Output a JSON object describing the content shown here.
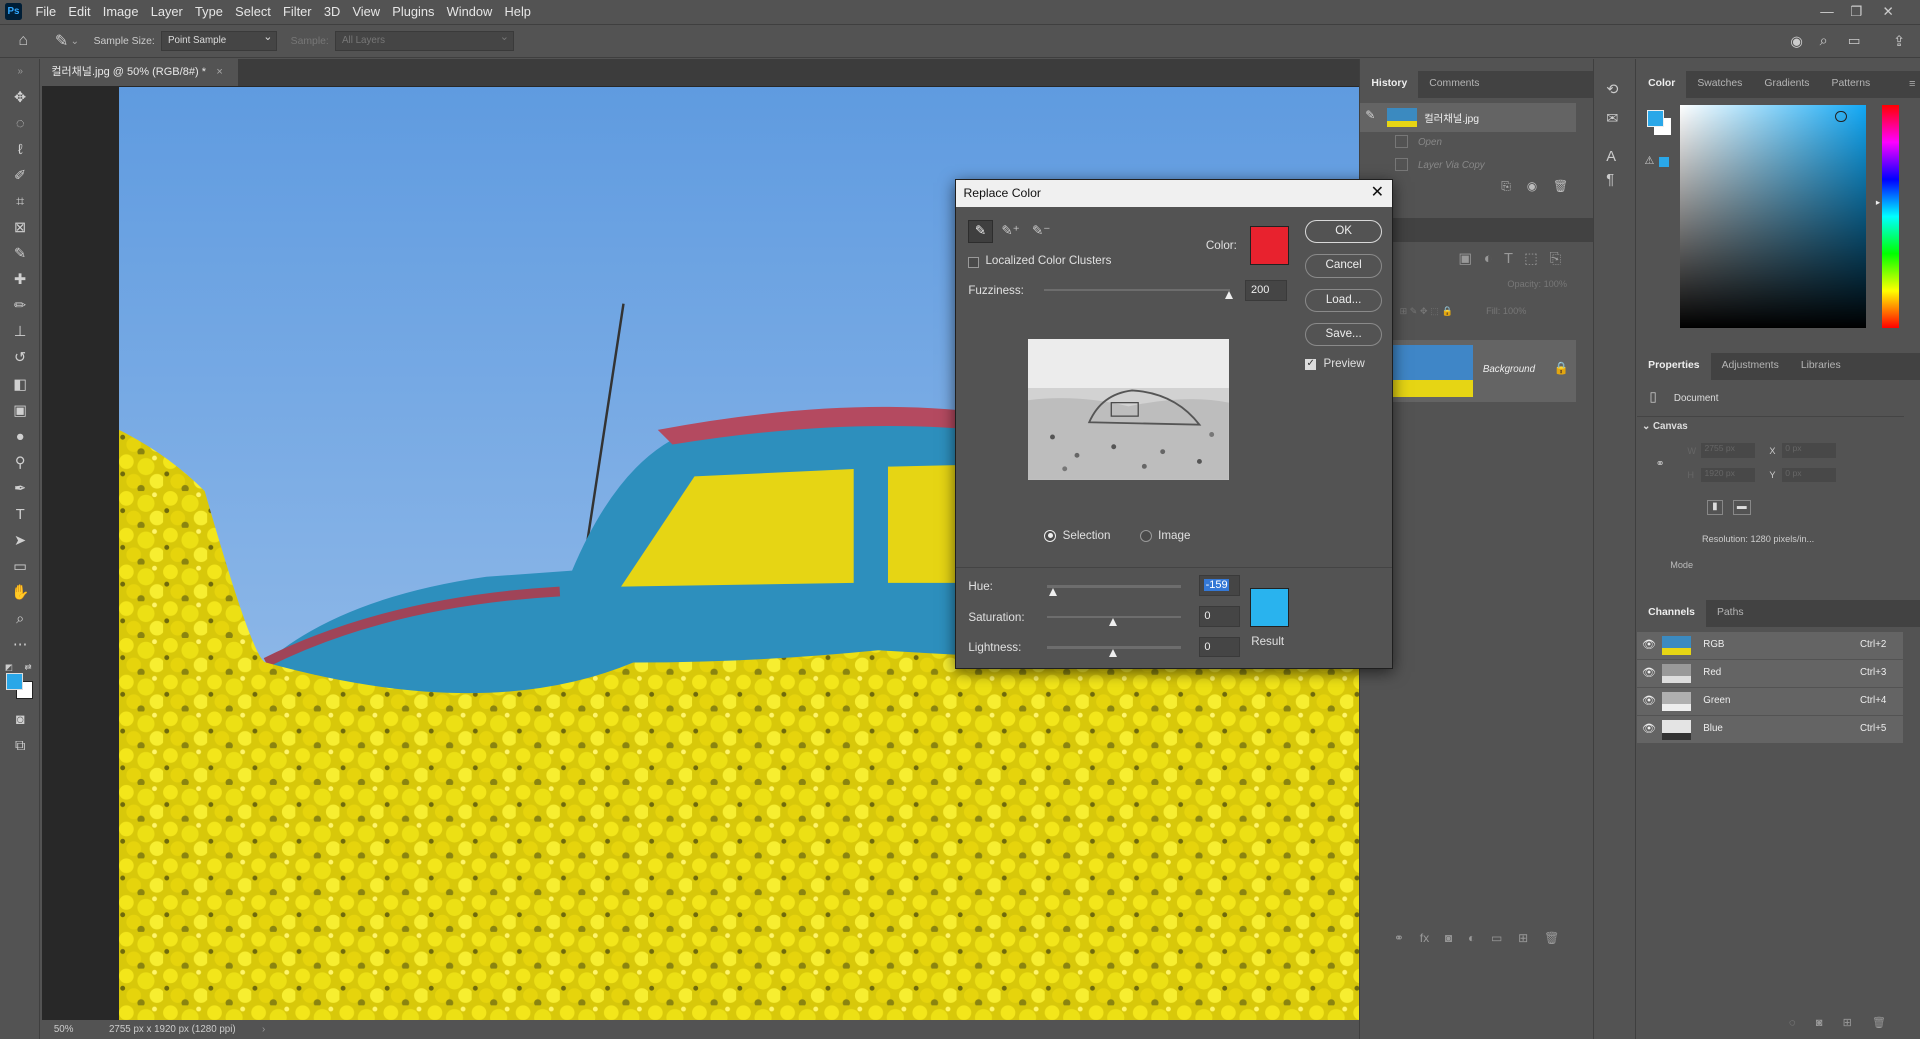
{
  "menu": {
    "app_logo": "Ps",
    "items": [
      "File",
      "Edit",
      "Image",
      "Layer",
      "Type",
      "Select",
      "Filter",
      "3D",
      "View",
      "Plugins",
      "Window",
      "Help"
    ]
  },
  "options": {
    "sample_size_label": "Sample Size:",
    "sample_size_value": "Point Sample",
    "sample_label": "Sample:",
    "sample_value": "All Layers"
  },
  "document": {
    "tab_title": "컬러채널.jpg @ 50% (RGB/8#) *",
    "zoom": "50%",
    "status_info": "2755 px x 1920 px (1280 ppi)"
  },
  "history": {
    "tabs": [
      "History",
      "Comments"
    ],
    "snapshot_name": "컬러채널.jpg",
    "steps": [
      "Open",
      "Layer Via Copy"
    ]
  },
  "layers": {
    "layer_name": "Background",
    "opacity_label": "Opacity:",
    "opacity_value": "100%",
    "fill_label": "Fill:",
    "fill_value": "100%"
  },
  "color_panel": {
    "tabs": [
      "Color",
      "Swatches",
      "Gradients",
      "Patterns"
    ],
    "foreground": "#2aa7e8",
    "background": "#ffffff"
  },
  "properties": {
    "tabs": [
      "Properties",
      "Adjustments",
      "Libraries"
    ],
    "doc_label": "Document",
    "section": "Canvas",
    "w_label": "W",
    "w_value": "2755 px",
    "h_label": "H",
    "h_value": "1920 px",
    "x_label": "X",
    "x_value": "0 px",
    "y_label": "Y",
    "y_value": "0 px",
    "resolution": "Resolution:  1280 pixels/in...",
    "mode_label": "Mode"
  },
  "channels": {
    "tabs": [
      "Channels",
      "Paths"
    ],
    "rows": [
      {
        "name": "RGB",
        "shortcut": "Ctrl+2"
      },
      {
        "name": "Red",
        "shortcut": "Ctrl+3"
      },
      {
        "name": "Green",
        "shortcut": "Ctrl+4"
      },
      {
        "name": "Blue",
        "shortcut": "Ctrl+5"
      }
    ]
  },
  "dialog": {
    "title": "Replace Color",
    "localized_label": "Localized Color Clusters",
    "color_label": "Color:",
    "sample_color": "#e8222e",
    "fuzziness_label": "Fuzziness:",
    "fuzziness_value": "200",
    "fuzziness_level": 1.0,
    "selection_label": "Selection",
    "image_label": "Image",
    "hue_label": "Hue:",
    "hue_value": "-159",
    "saturation_label": "Saturation:",
    "saturation_value": "0",
    "lightness_label": "Lightness:",
    "lightness_value": "0",
    "result_label": "Result",
    "result_color": "#29b3ee",
    "buttons": {
      "ok": "OK",
      "cancel": "Cancel",
      "load": "Load...",
      "save": "Save..."
    },
    "preview_label": "Preview"
  }
}
